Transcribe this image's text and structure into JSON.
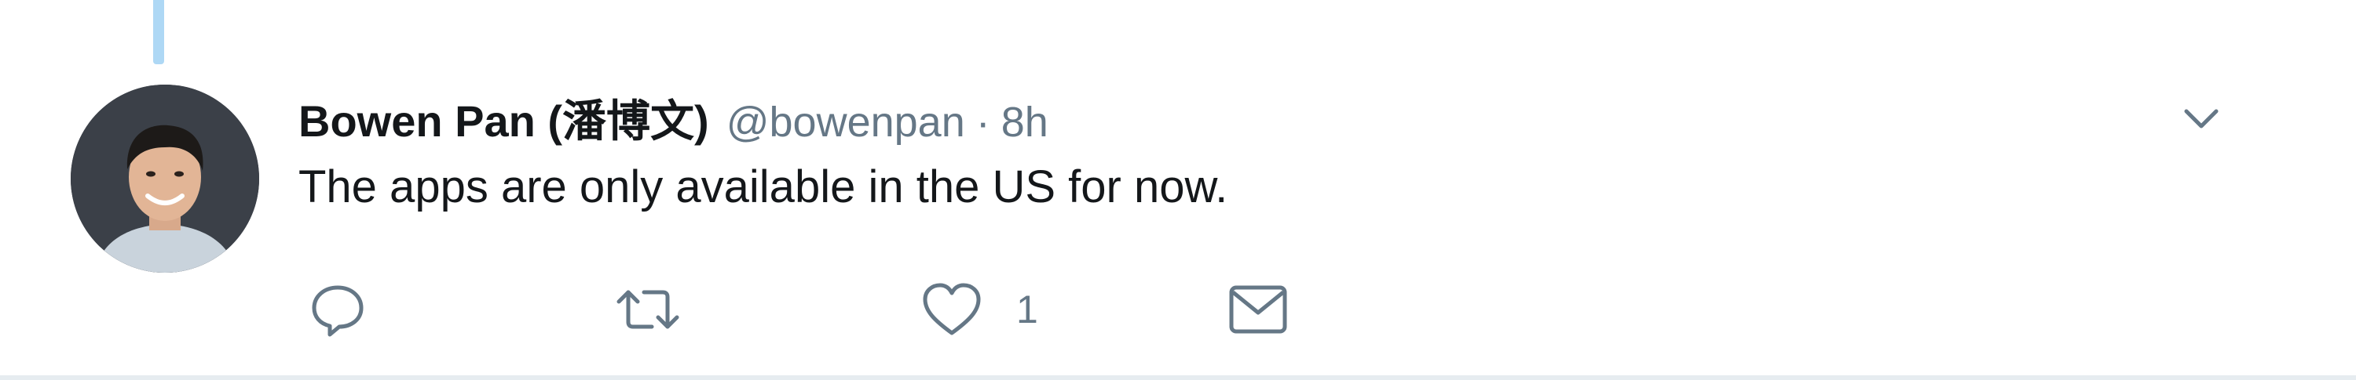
{
  "tweet": {
    "author": {
      "display_name": "Bowen Pan (潘博文)",
      "handle": "@bowenpan",
      "avatar_icon": "user-avatar"
    },
    "separator": "·",
    "timestamp": "8h",
    "text": "The apps are only available in the US for now.",
    "actions": {
      "reply_icon": "reply-icon",
      "retweet_icon": "retweet-icon",
      "like_icon": "heart-icon",
      "like_count": "1",
      "dm_icon": "envelope-icon"
    },
    "menu_icon": "chevron-down-icon"
  },
  "colors": {
    "text_primary": "#14171a",
    "text_secondary": "#657786",
    "thread_line": "#aed8f5",
    "divider": "#e6ecf0"
  }
}
